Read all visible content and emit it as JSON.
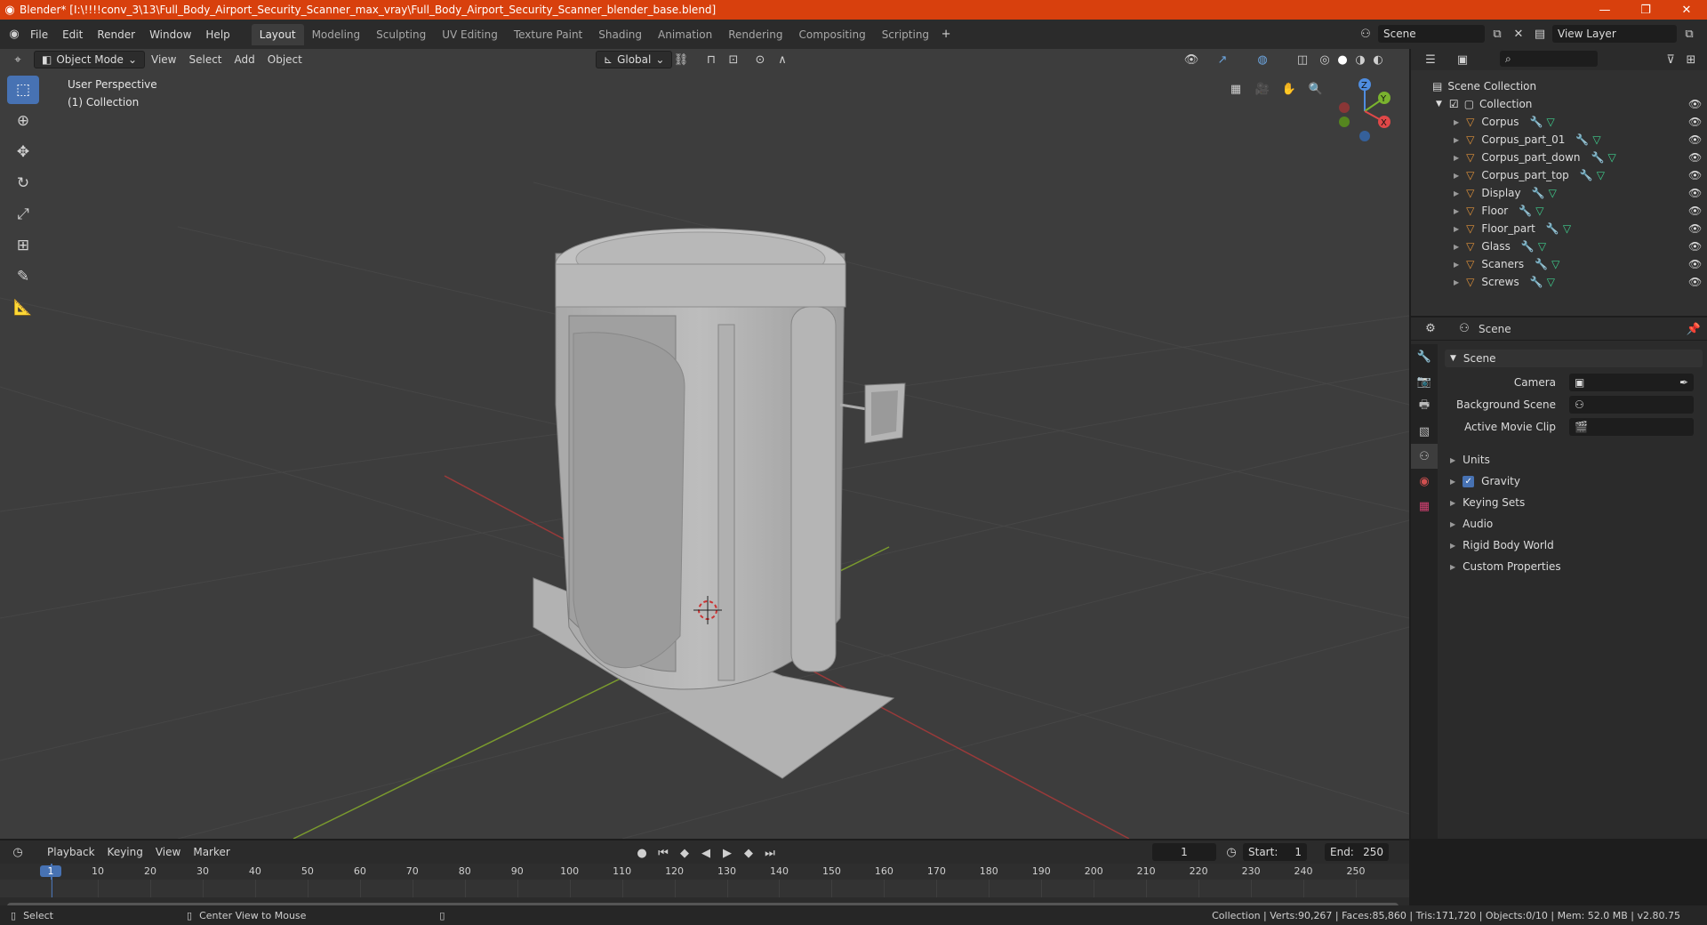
{
  "title_bar": {
    "title": "Blender* [I:\\!!!!conv_3\\13\\Full_Body_Airport_Security_Scanner_max_vray\\Full_Body_Airport_Security_Scanner_blender_base.blend]"
  },
  "menu": [
    "File",
    "Edit",
    "Render",
    "Window",
    "Help"
  ],
  "workspaces": [
    "Layout",
    "Modeling",
    "Sculpting",
    "UV Editing",
    "Texture Paint",
    "Shading",
    "Animation",
    "Rendering",
    "Compositing",
    "Scripting"
  ],
  "active_workspace": "Layout",
  "scene_field": "Scene",
  "view_layer_field": "View Layer",
  "viewport": {
    "mode": "Object Mode",
    "menus": [
      "View",
      "Select",
      "Add",
      "Object"
    ],
    "transform_orientation": "Global",
    "overlay_text": [
      "User Perspective",
      "(1) Collection"
    ]
  },
  "outliner": {
    "root": "Scene Collection",
    "collection": "Collection",
    "objects": [
      "Corpus",
      "Corpus_part_01",
      "Corpus_part_down",
      "Corpus_part_top",
      "Display",
      "Floor",
      "Floor_part",
      "Glass",
      "Scaners",
      "Screws"
    ]
  },
  "properties": {
    "header": "Scene",
    "panel_title": "Scene",
    "camera_label": "Camera",
    "background_scene_label": "Background Scene",
    "active_movie_clip_label": "Active Movie Clip",
    "sections": [
      "Units",
      "Gravity",
      "Keying Sets",
      "Audio",
      "Rigid Body World",
      "Custom Properties"
    ],
    "gravity_checked": true
  },
  "timeline": {
    "menus": [
      "Playback",
      "Keying",
      "View",
      "Marker"
    ],
    "current_frame": "1",
    "start_label": "Start:",
    "start_value": "1",
    "end_label": "End:",
    "end_value": "250",
    "ruler_ticks": [
      "1",
      "10",
      "20",
      "30",
      "40",
      "50",
      "60",
      "70",
      "80",
      "90",
      "100",
      "110",
      "120",
      "130",
      "140",
      "150",
      "160",
      "170",
      "180",
      "190",
      "200",
      "210",
      "220",
      "230",
      "240",
      "250"
    ]
  },
  "status_bar": {
    "select": "Select",
    "center_view": "Center View to Mouse",
    "stats": "Collection | Verts:90,267 | Faces:85,860 | Tris:171,720 | Objects:0/10 | Mem: 52.0 MB | v2.80.75"
  },
  "colors": {
    "title_bar": "#d8400d",
    "accent_blue": "#4772b3",
    "viewport_bg": "#3d3d3d",
    "object_orange": "#e0923a",
    "modifier_blue": "#6da6e0",
    "mesh_green": "#3fcf8e"
  }
}
